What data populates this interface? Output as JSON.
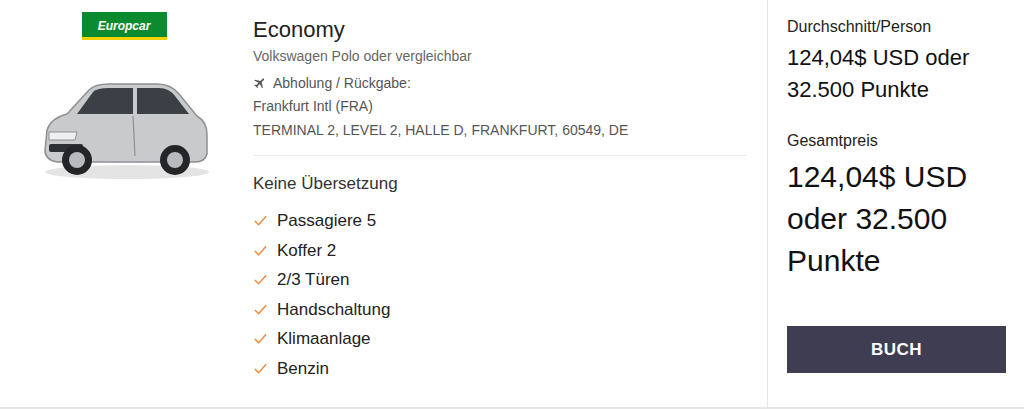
{
  "vendor": {
    "logo": "Europcar"
  },
  "car": {
    "category": "Economy",
    "model": "Volkswagen Polo oder vergleichbar"
  },
  "pickup": {
    "label": "Abholung / Rückgabe:",
    "location": "Frankfurt Intl (FRA)",
    "address": "TERMINAL 2, LEVEL 2, HALLE D, FRANKFURT, 60549, DE"
  },
  "translation_note": "Keine Übersetzung",
  "features": [
    {
      "label": "Passagiere 5"
    },
    {
      "label": "Koffer 2"
    },
    {
      "label": "2/3 Türen"
    },
    {
      "label": "Handschaltung"
    },
    {
      "label": "Klimaanlage"
    },
    {
      "label": "Benzin"
    }
  ],
  "pricing": {
    "per_person_label": "Durchschnitt/Person",
    "per_person": "124,04$ USD oder 32.500 Punkte",
    "total_label": "Gesamtpreis",
    "total": "124,04$ USD oder 32.500 Punkte"
  },
  "buttons": [
    "BUCH"
  ]
}
